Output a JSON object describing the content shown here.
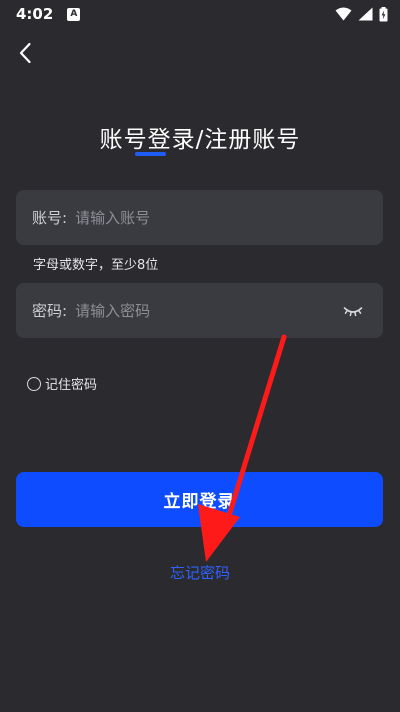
{
  "status_bar": {
    "time": "4:02",
    "notification_icon_letter": "A",
    "icons": [
      "a-notification-icon",
      "wifi-icon",
      "signal-icon",
      "battery-charging-icon"
    ]
  },
  "header": {
    "back_icon": "chevron-left-icon",
    "title": "账号登录/注册账号"
  },
  "form": {
    "account": {
      "label": "账号:",
      "placeholder": "请输入账号",
      "value": ""
    },
    "account_hint": "字母或数字，至少8位",
    "password": {
      "label": "密码:",
      "placeholder": "请输入密码",
      "value": "",
      "toggle_icon": "eye-closed-icon"
    },
    "remember_label": "记住密码",
    "login_label": "立即登录",
    "forgot_label": "忘记密码"
  },
  "colors": {
    "background": "#2b2b2f",
    "field_background": "#3a3b40",
    "primary": "#0d4dff",
    "link": "#2f62ff",
    "annotation": "#ff1a1a"
  }
}
